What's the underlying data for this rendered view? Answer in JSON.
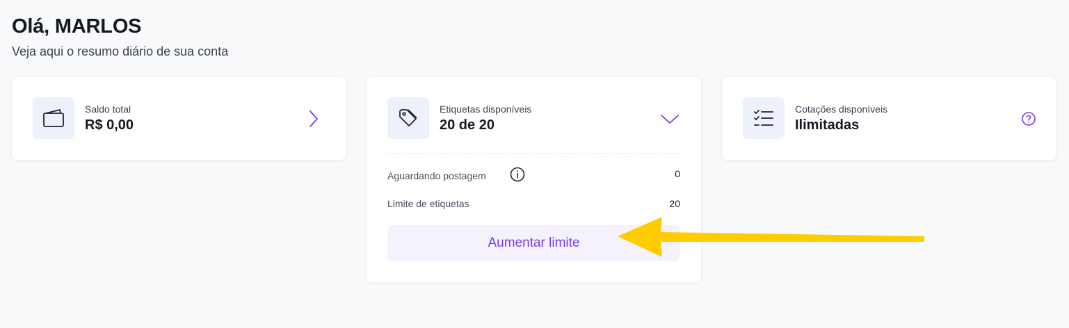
{
  "header": {
    "greeting": "Olá, MARLOS",
    "subtitle": "Veja aqui o resumo diário de sua conta"
  },
  "cards": {
    "saldo": {
      "icon": "wallet-icon",
      "label": "Saldo total",
      "value": "R$ 0,00",
      "action_icon": "chevron-right-icon"
    },
    "etiquetas": {
      "icon": "tag-icon",
      "label": "Etiquetas disponíveis",
      "value": "20 de 20",
      "action_icon": "chevron-down-icon",
      "rows": [
        {
          "label": "Aguardando postagem",
          "value": "0",
          "icon": "info-icon"
        },
        {
          "label": "Limite de etiquetas",
          "value": "20"
        }
      ],
      "button_label": "Aumentar limite"
    },
    "cotacoes": {
      "icon": "checklist-icon",
      "label": "Cotações disponíveis",
      "value": "Ilimitadas",
      "action_icon": "help-circle-icon"
    }
  },
  "colors": {
    "accent": "#7c3aed",
    "icon_bg": "#ecf1fc",
    "button_bg": "#f5f2fe",
    "arrow": "#ffcc00",
    "page_bg": "#f8f9fb"
  }
}
